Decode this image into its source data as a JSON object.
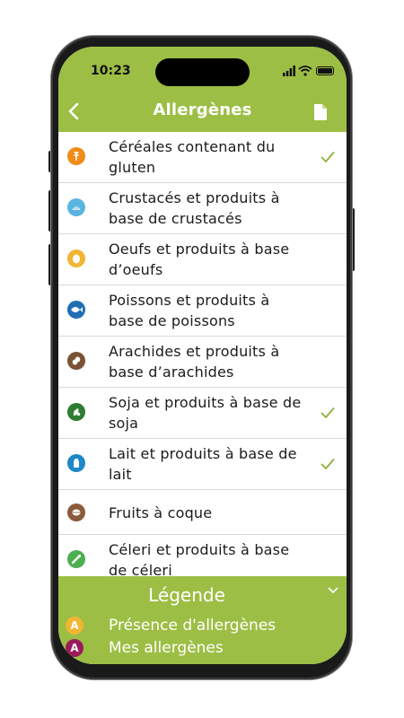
{
  "status_bar": {
    "time": "10:23"
  },
  "header": {
    "title": "Allergènes",
    "back_icon": "chevron-left-icon",
    "action_icon": "document-icon"
  },
  "allergens": [
    {
      "label": "Céréales contenant du gluten",
      "icon": "wheat-icon",
      "color": "#ef8c1a",
      "checked": true
    },
    {
      "label": "Crustacés et produits à base de crustacés",
      "icon": "shell-icon",
      "color": "#5ab4e0",
      "checked": false
    },
    {
      "label": "Oeufs et produits à base d’oeufs",
      "icon": "egg-icon",
      "color": "#f2b634",
      "checked": false
    },
    {
      "label": "Poissons et produits à base de poissons",
      "icon": "fish-icon",
      "color": "#1e6db5",
      "checked": false
    },
    {
      "label": "Arachides et produits à base d’arachides",
      "icon": "peanut-icon",
      "color": "#7a5233",
      "checked": false
    },
    {
      "label": "Soja et produits à base de soja",
      "icon": "soy-icon",
      "color": "#2e7d32",
      "checked": true
    },
    {
      "label": "Lait et produits à base de lait",
      "icon": "milk-icon",
      "color": "#1e88c8",
      "checked": true
    },
    {
      "label": "Fruits à coque",
      "icon": "nut-icon",
      "color": "#8a5a3a",
      "checked": false
    },
    {
      "label": "Céleri et produits à base de céleri",
      "icon": "celery-icon",
      "color": "#4caf50",
      "checked": false
    }
  ],
  "legend": {
    "title": "Légende",
    "items": [
      {
        "badge": "A",
        "label": "Présence d'allergènes",
        "color": "#f2b634"
      },
      {
        "badge": "A",
        "label": "Mes allergènes",
        "color": "#9b1b5a"
      }
    ]
  },
  "colors": {
    "accent": "#9dbe45",
    "check": "#8db23e"
  }
}
